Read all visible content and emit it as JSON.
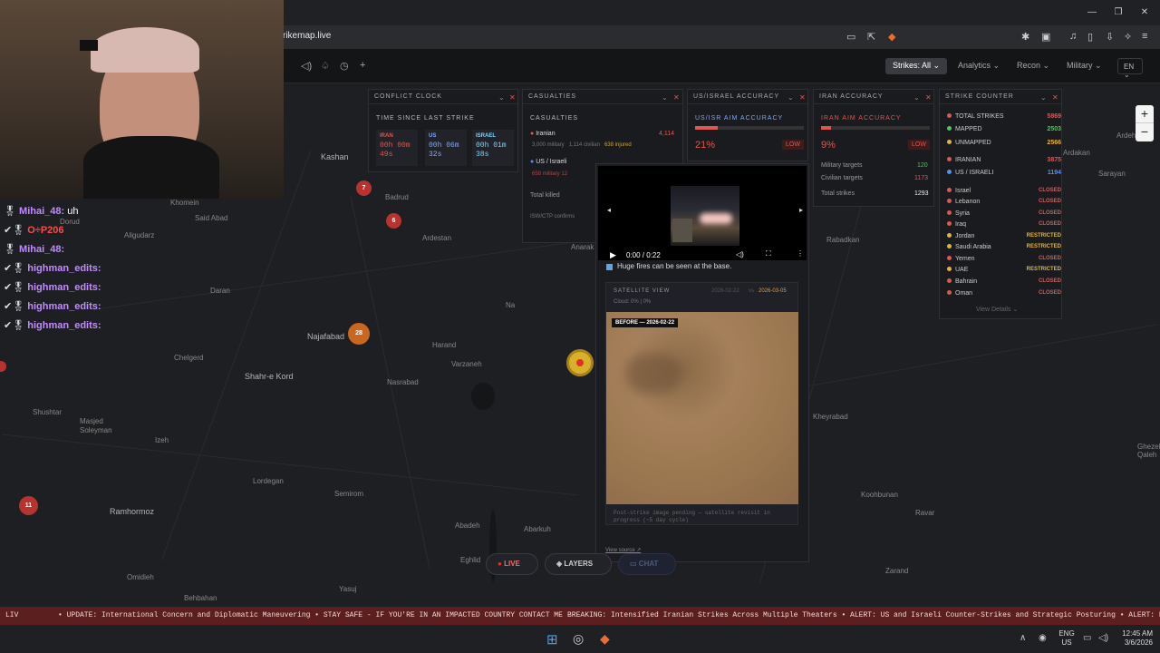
{
  "browser": {
    "url": "rikemap.live"
  },
  "header": {
    "nav": [
      {
        "label": "Strikes: All ⌄"
      },
      {
        "label": "Analytics ⌄"
      },
      {
        "label": "Recon ⌄"
      },
      {
        "label": "Military ⌄"
      }
    ],
    "lang": "EN ⌄"
  },
  "map_places": [
    "Kashan",
    "Badrud",
    "Khomein",
    "Said Abad",
    "Aligudarz",
    "Dorud",
    "Ardestan",
    "Daran",
    "Najafabad",
    "Harand",
    "Varzaneh",
    "Chelgerd",
    "Shahr-e Kord",
    "Nasrabad",
    "Shushtar",
    "Masjed Soleyman",
    "Izeh",
    "Lordegan",
    "Semirom",
    "Ramhormoz",
    "Abadeh",
    "Abarkuh",
    "Eghlid",
    "Yasuj",
    "Omidieh",
    "Behbahan",
    "Anarak",
    "Na",
    "Kheyrabad",
    "Rabadkan",
    "Ardakan",
    "Sarayan",
    "Ghezel Qaleh",
    "Koohbunan",
    "Ravar",
    "Zarand",
    "Ardehi"
  ],
  "markers": {
    "m7": "7",
    "m6": "6",
    "m28": "28",
    "m11": "11"
  },
  "conflict_clock": {
    "title": "CONFLICT CLOCK",
    "subtitle": "TIME SINCE LAST STRIKE",
    "cells": [
      {
        "label": "IRAN",
        "time": "00h 00m 49s"
      },
      {
        "label": "US",
        "time": "00h 06m 32s"
      },
      {
        "label": "ISRAEL",
        "time": "00h 01m 38s"
      }
    ]
  },
  "casualties": {
    "title": "CASUALTIES",
    "subtitle": "CASUALTIES",
    "iranian": {
      "label": "Iranian",
      "total": "4,114",
      "military": "3,000 military",
      "civilian": "1,114 civilian",
      "injured": "638 injured"
    },
    "us_israeli": {
      "label": "US / Israeli",
      "military": "658 military",
      "extra": "12"
    },
    "total_killed": "Total killed",
    "source": "ISW/CTP confirms"
  },
  "us_accuracy": {
    "title": "US/ISRAEL ACCURACY",
    "subtitle": "US/ISR AIM ACCURACY",
    "value": "21%",
    "badge": "LOW"
  },
  "iran_accuracy": {
    "title": "IRAN ACCURACY",
    "subtitle": "IRAN AIM ACCURACY",
    "value": "9%",
    "badge": "LOW",
    "rows": [
      {
        "label": "Military targets",
        "value": "120"
      },
      {
        "label": "Civilian targets",
        "value": "1173"
      },
      {
        "label": "Total strikes",
        "value": "1293"
      }
    ]
  },
  "strike_counter": {
    "title": "STRIKE COUNTER",
    "rows": [
      {
        "label": "TOTAL STRIKES",
        "value": "5869",
        "color": "#e0574f"
      },
      {
        "label": "MAPPED",
        "value": "2503",
        "color": "#56c25a"
      },
      {
        "label": "UNMAPPED",
        "value": "2566",
        "color": "#e3b33c"
      },
      {
        "label": "IRANIAN",
        "value": "3875",
        "color": "#e0574f"
      },
      {
        "label": "US / ISRAELI",
        "value": "1194",
        "color": "#5b8dee"
      }
    ],
    "countries": [
      {
        "name": "Israel",
        "status": "CLOSED"
      },
      {
        "name": "Lebanon",
        "status": "CLOSED"
      },
      {
        "name": "Syria",
        "status": "CLOSED"
      },
      {
        "name": "Iraq",
        "status": "CLOSED"
      },
      {
        "name": "Jordan",
        "status": "RESTRICTED"
      },
      {
        "name": "Saudi Arabia",
        "status": "RESTRICTED"
      },
      {
        "name": "Yemen",
        "status": "CLOSED"
      },
      {
        "name": "UAE",
        "status": "RESTRICTED"
      },
      {
        "name": "Bahrain",
        "status": "CLOSED"
      },
      {
        "name": "Oman",
        "status": "CLOSED"
      }
    ],
    "view_details": "View Details ⌄"
  },
  "popup": {
    "video_time": "0:00 / 0:22",
    "caption": "Huge fires can be seen at the base.",
    "sat_label": "SATELLITE VIEW",
    "date_before": "2026-02-22",
    "vs": "vs",
    "date_after": "2026-03-05",
    "cloud": "Cloud: 0% | 0%",
    "before_tag": "BEFORE — 2026-02-22",
    "pending": "Post-strike image pending — satellite revisit in progress (~5 day cycle)",
    "view_source": "View source ↗"
  },
  "bottom_buttons": {
    "live": "LIVE",
    "layers": "LAYERS",
    "chat": "CHAT"
  },
  "ticker": {
    "prefix": "LIV",
    "part1": "• UPDATE: International Concern and Diplomatic Maneuvering • STAY SAFE - IF YOU'RE IN AN IMPACTED COUNTRY CONTACT ME",
    "part2": "BREAKING: Intensified Iranian Strikes Across Multiple Theaters • ALERT: US and Israeli Counter-Strikes and Strategic Posturing • ALERT: Reports of"
  },
  "chat": [
    {
      "name": "Mihai_48:",
      "msg": "uh"
    },
    {
      "name": "O÷P206",
      "msg": ""
    },
    {
      "name": "Mihai_48:",
      "msg": ""
    },
    {
      "name": "highman_edits:",
      "msg": ""
    },
    {
      "name": "highman_edits:",
      "msg": ""
    },
    {
      "name": "highman_edits:",
      "msg": ""
    },
    {
      "name": "highman_edits:",
      "msg": ""
    }
  ],
  "taskbar": {
    "lang1": "ENG",
    "lang2": "US",
    "time": "12:45 AM",
    "date": "3/6/2026"
  },
  "colors": {
    "accent_red": "#e0574f",
    "ticker_bg": "#5c1f1f",
    "green": "#56c25a",
    "yellow": "#e3b33c",
    "blue": "#5b8dee"
  }
}
